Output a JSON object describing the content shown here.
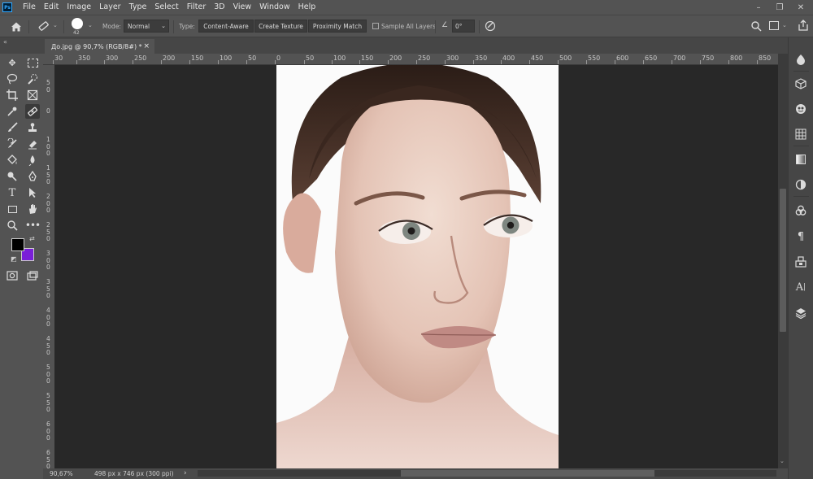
{
  "app": {
    "logo_text": "Ps"
  },
  "menu": [
    "File",
    "Edit",
    "Image",
    "Layer",
    "Type",
    "Select",
    "Filter",
    "3D",
    "View",
    "Window",
    "Help"
  ],
  "window_controls": {
    "minimize": "–",
    "restore": "❐",
    "close": "✕"
  },
  "options_bar": {
    "brush_size": "42",
    "mode_label": "Mode:",
    "mode_value": "Normal",
    "type_label": "Type:",
    "type_options": [
      "Content-Aware",
      "Create Texture",
      "Proximity Match"
    ],
    "sample_all_layers": "Sample All Layers",
    "angle_value": "0°"
  },
  "document_tab": {
    "title": "До.jpg @ 90,7% (RGB/8#) *",
    "close": "×"
  },
  "ruler": {
    "horizontal": [
      "30",
      "350",
      "300",
      "250",
      "200",
      "150",
      "100",
      "50",
      "0",
      "50",
      "100",
      "150",
      "200",
      "250",
      "300",
      "350",
      "400",
      "450",
      "500",
      "550",
      "600",
      "650",
      "700",
      "750",
      "800",
      "850"
    ],
    "vertical": [
      "50",
      "0",
      "100",
      "150",
      "200",
      "250",
      "300",
      "350",
      "400",
      "450",
      "500",
      "550",
      "600",
      "650",
      "7"
    ]
  },
  "tools": {
    "foreground_color": "#000000",
    "background_color": "#7a1fd8"
  },
  "status_bar": {
    "zoom": "90,67%",
    "doc_info": "498 px x 746 px (300 ppi)",
    "arrow": "›"
  },
  "colors": {
    "accent": "#31a8ff",
    "workspace": "#282828",
    "ui": "#535353"
  }
}
